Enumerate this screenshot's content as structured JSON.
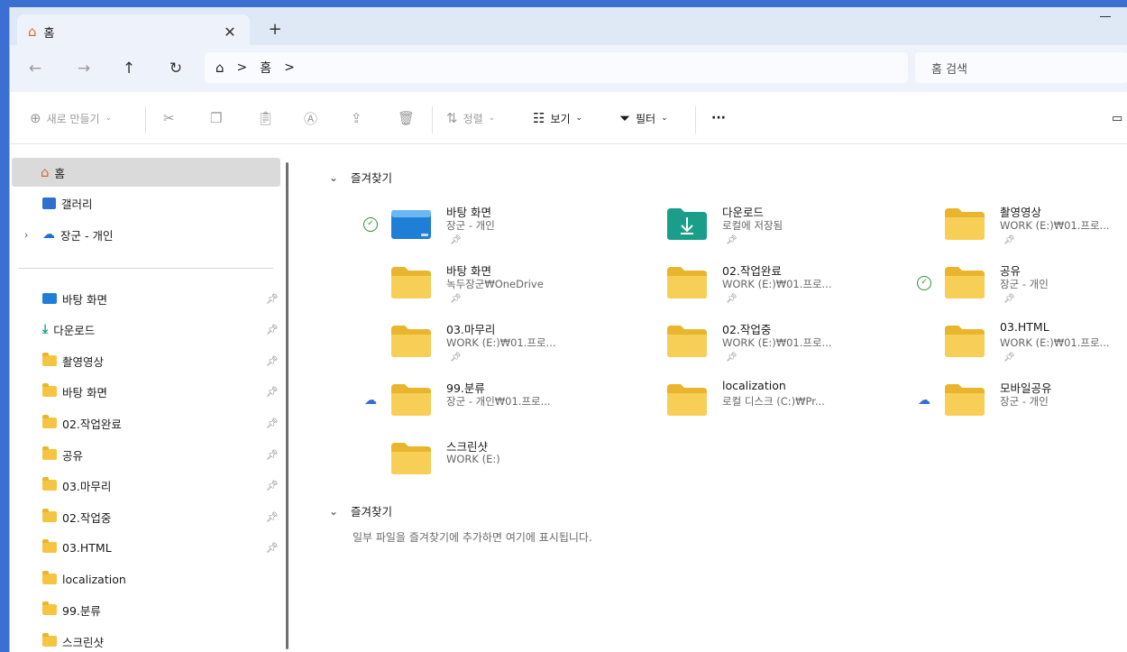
{
  "window": {
    "tab_title": "홈",
    "tab_close": "✕",
    "new_tab": "+"
  },
  "address": {
    "breadcrumb_current": "홈",
    "breadcrumb_sep": ">",
    "search_placeholder": "홈 검색"
  },
  "toolbar": {
    "new_label": "새로 만들기",
    "sort_label": "정렬",
    "view_label": "보기",
    "filter_label": "필터",
    "more_label": "···"
  },
  "sidebar": {
    "items": [
      {
        "label": "홈",
        "icon": "home-icon",
        "selected": true
      },
      {
        "label": "갤러리",
        "icon": "gallery-icon"
      },
      {
        "label": "장군 - 개인",
        "icon": "onedrive-icon",
        "expandable": true
      },
      {
        "label": "바탕 화면",
        "icon": "desktop-icon",
        "pinned": true
      },
      {
        "label": "다운로드",
        "icon": "download-icon",
        "pinned": true
      },
      {
        "label": "촬영영상",
        "icon": "folder-icon",
        "pinned": true
      },
      {
        "label": "바탕 화면",
        "icon": "folder-icon",
        "pinned": true
      },
      {
        "label": "02.작업완료",
        "icon": "folder-icon",
        "pinned": true
      },
      {
        "label": "공유",
        "icon": "folder-icon",
        "pinned": true
      },
      {
        "label": "03.마무리",
        "icon": "folder-icon",
        "pinned": true
      },
      {
        "label": "02.작업중",
        "icon": "folder-icon",
        "pinned": true
      },
      {
        "label": "03.HTML",
        "icon": "folder-icon",
        "pinned": true
      },
      {
        "label": "localization",
        "icon": "folder-icon"
      },
      {
        "label": "99.분류",
        "icon": "folder-icon"
      },
      {
        "label": "스크린샷",
        "icon": "folder-icon"
      }
    ]
  },
  "main": {
    "favorites_header": "즐겨찾기",
    "recent_header": "즐겨찾기",
    "recent_empty_msg": "일부 파일을 즐겨찾기에 추가하면 여기에 표시됩니다.",
    "tiles": [
      {
        "name": "바탕 화면",
        "sub": "장군 - 개인",
        "status": "synced",
        "icon": "desktop-folder"
      },
      {
        "name": "다운로드",
        "sub": "로컬에 저장됨",
        "status": "",
        "icon": "download-folder"
      },
      {
        "name": "촬영영상",
        "sub": "WORK (E:)₩01.프로...",
        "status": "",
        "icon": "folder"
      },
      {
        "name": "바탕 화면",
        "sub": "녹두장군₩OneDrive",
        "status": "",
        "icon": "folder"
      },
      {
        "name": "02.작업완료",
        "sub": "WORK (E:)₩01.프로...",
        "status": "",
        "icon": "folder"
      },
      {
        "name": "공유",
        "sub": "장군 - 개인",
        "status": "synced",
        "icon": "folder"
      },
      {
        "name": "03.마무리",
        "sub": "WORK (E:)₩01.프로...",
        "status": "",
        "icon": "folder"
      },
      {
        "name": "02.작업중",
        "sub": "WORK (E:)₩01.프로...",
        "status": "",
        "icon": "folder"
      },
      {
        "name": "03.HTML",
        "sub": "WORK (E:)₩01.프로...",
        "status": "",
        "icon": "folder"
      },
      {
        "name": "99.분류",
        "sub": "장군 - 개인₩01.프로...",
        "status": "cloud",
        "icon": "folder"
      },
      {
        "name": "localization",
        "sub": "로컬 디스크 (C:)₩Pr...",
        "status": "",
        "icon": "folder"
      },
      {
        "name": "모바일공유",
        "sub": "장군 - 개인",
        "status": "cloud",
        "icon": "folder"
      },
      {
        "name": "스크린샷",
        "sub": "WORK (E:)",
        "status": "",
        "icon": "folder"
      }
    ]
  },
  "colors": {
    "folder_yellow": "#f5c542",
    "desktop_blue": "#1f7fd6",
    "download_teal": "#1a9e8a",
    "sync_green": "#2f8f3a",
    "cloud_blue": "#2f6fd1"
  }
}
